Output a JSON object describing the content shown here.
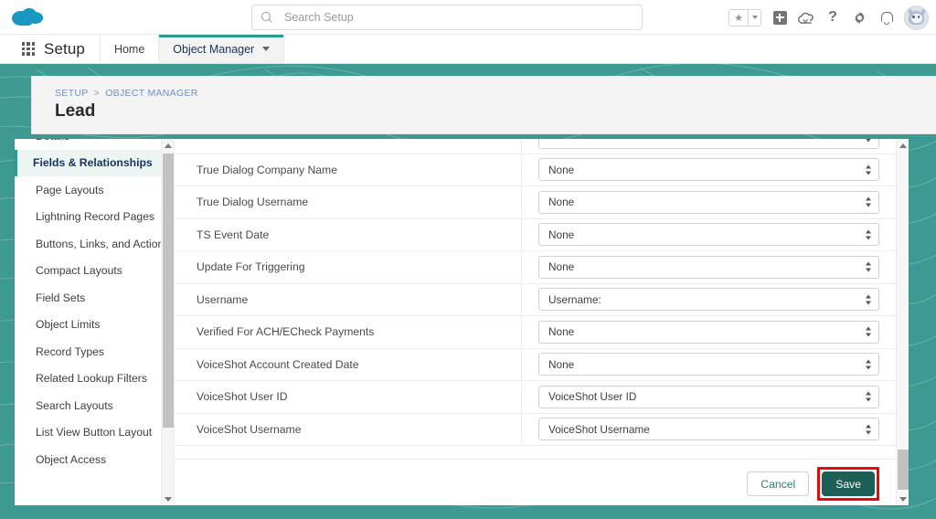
{
  "header": {
    "logo_icon": "salesforce-cloud-logo",
    "search": {
      "placeholder": "Search Setup",
      "value": "",
      "icon": "search-icon"
    },
    "icons": [
      {
        "name": "favorites-star-icon",
        "glyph": "★"
      },
      {
        "name": "favorites-dropdown-caret-icon",
        "glyph": "▾"
      },
      {
        "name": "global-actions-plus-icon",
        "glyph": "+"
      },
      {
        "name": "setup-cloud-icon",
        "glyph": "☁"
      },
      {
        "name": "help-question-icon",
        "glyph": "?"
      },
      {
        "name": "settings-gear-icon",
        "glyph": "⚙"
      },
      {
        "name": "notifications-bell-icon",
        "glyph": "🔔"
      },
      {
        "name": "user-avatar",
        "glyph": ""
      }
    ]
  },
  "setup_bar": {
    "app_launcher_icon": "app-launcher-waffle-icon",
    "title": "Setup",
    "tabs": [
      {
        "label": "Home",
        "active": false,
        "has_caret": false
      },
      {
        "label": "Object Manager",
        "active": true,
        "has_caret": true
      }
    ]
  },
  "page": {
    "breadcrumb": {
      "items": [
        "SETUP",
        "OBJECT MANAGER"
      ],
      "separator": ">"
    },
    "title": "Lead"
  },
  "sidebar": {
    "items": [
      {
        "label": "Details",
        "active": false
      },
      {
        "label": "Fields & Relationships",
        "active": true
      },
      {
        "label": "Page Layouts",
        "active": false
      },
      {
        "label": "Lightning Record Pages",
        "active": false
      },
      {
        "label": "Buttons, Links, and Actions",
        "active": false
      },
      {
        "label": "Compact Layouts",
        "active": false
      },
      {
        "label": "Field Sets",
        "active": false
      },
      {
        "label": "Object Limits",
        "active": false
      },
      {
        "label": "Record Types",
        "active": false
      },
      {
        "label": "Related Lookup Filters",
        "active": false
      },
      {
        "label": "Search Layouts",
        "active": false
      },
      {
        "label": "List View Button Layout",
        "active": false
      },
      {
        "label": "Object Access",
        "active": false
      }
    ],
    "scroll_up_icon": "scroll-up-arrow-icon",
    "scroll_down_icon": "scroll-down-arrow-icon"
  },
  "field_mapping_table": {
    "rows": [
      {
        "field_label": "",
        "select_value": "",
        "partial": true
      },
      {
        "field_label": "True Dialog Company Name",
        "select_value": "None",
        "partial": false
      },
      {
        "field_label": "True Dialog Username",
        "select_value": "None",
        "partial": false
      },
      {
        "field_label": "TS Event Date",
        "select_value": "None",
        "partial": false
      },
      {
        "field_label": "Update For Triggering",
        "select_value": "None",
        "partial": false
      },
      {
        "field_label": "Username",
        "select_value": "Username:",
        "partial": false
      },
      {
        "field_label": "Verified For ACH/ECheck Payments",
        "select_value": "None",
        "partial": false
      },
      {
        "field_label": "VoiceShot Account Created Date",
        "select_value": "None",
        "partial": false
      },
      {
        "field_label": "VoiceShot User ID",
        "select_value": "VoiceShot User ID",
        "partial": false
      },
      {
        "field_label": "VoiceShot Username",
        "select_value": "VoiceShot Username",
        "partial": false
      }
    ]
  },
  "actions": {
    "cancel_label": "Cancel",
    "save_label": "Save",
    "save_highlighted": true
  },
  "colors": {
    "brand_teal": "#3d9a92",
    "accent_teal": "#2e9a8d",
    "save_button_bg": "#1d5f56",
    "highlight_red": "#e60b0b",
    "logo_blue": "#1798c1",
    "active_item_bg": "#edf5f3",
    "link_blue": "#6f8dc4"
  }
}
